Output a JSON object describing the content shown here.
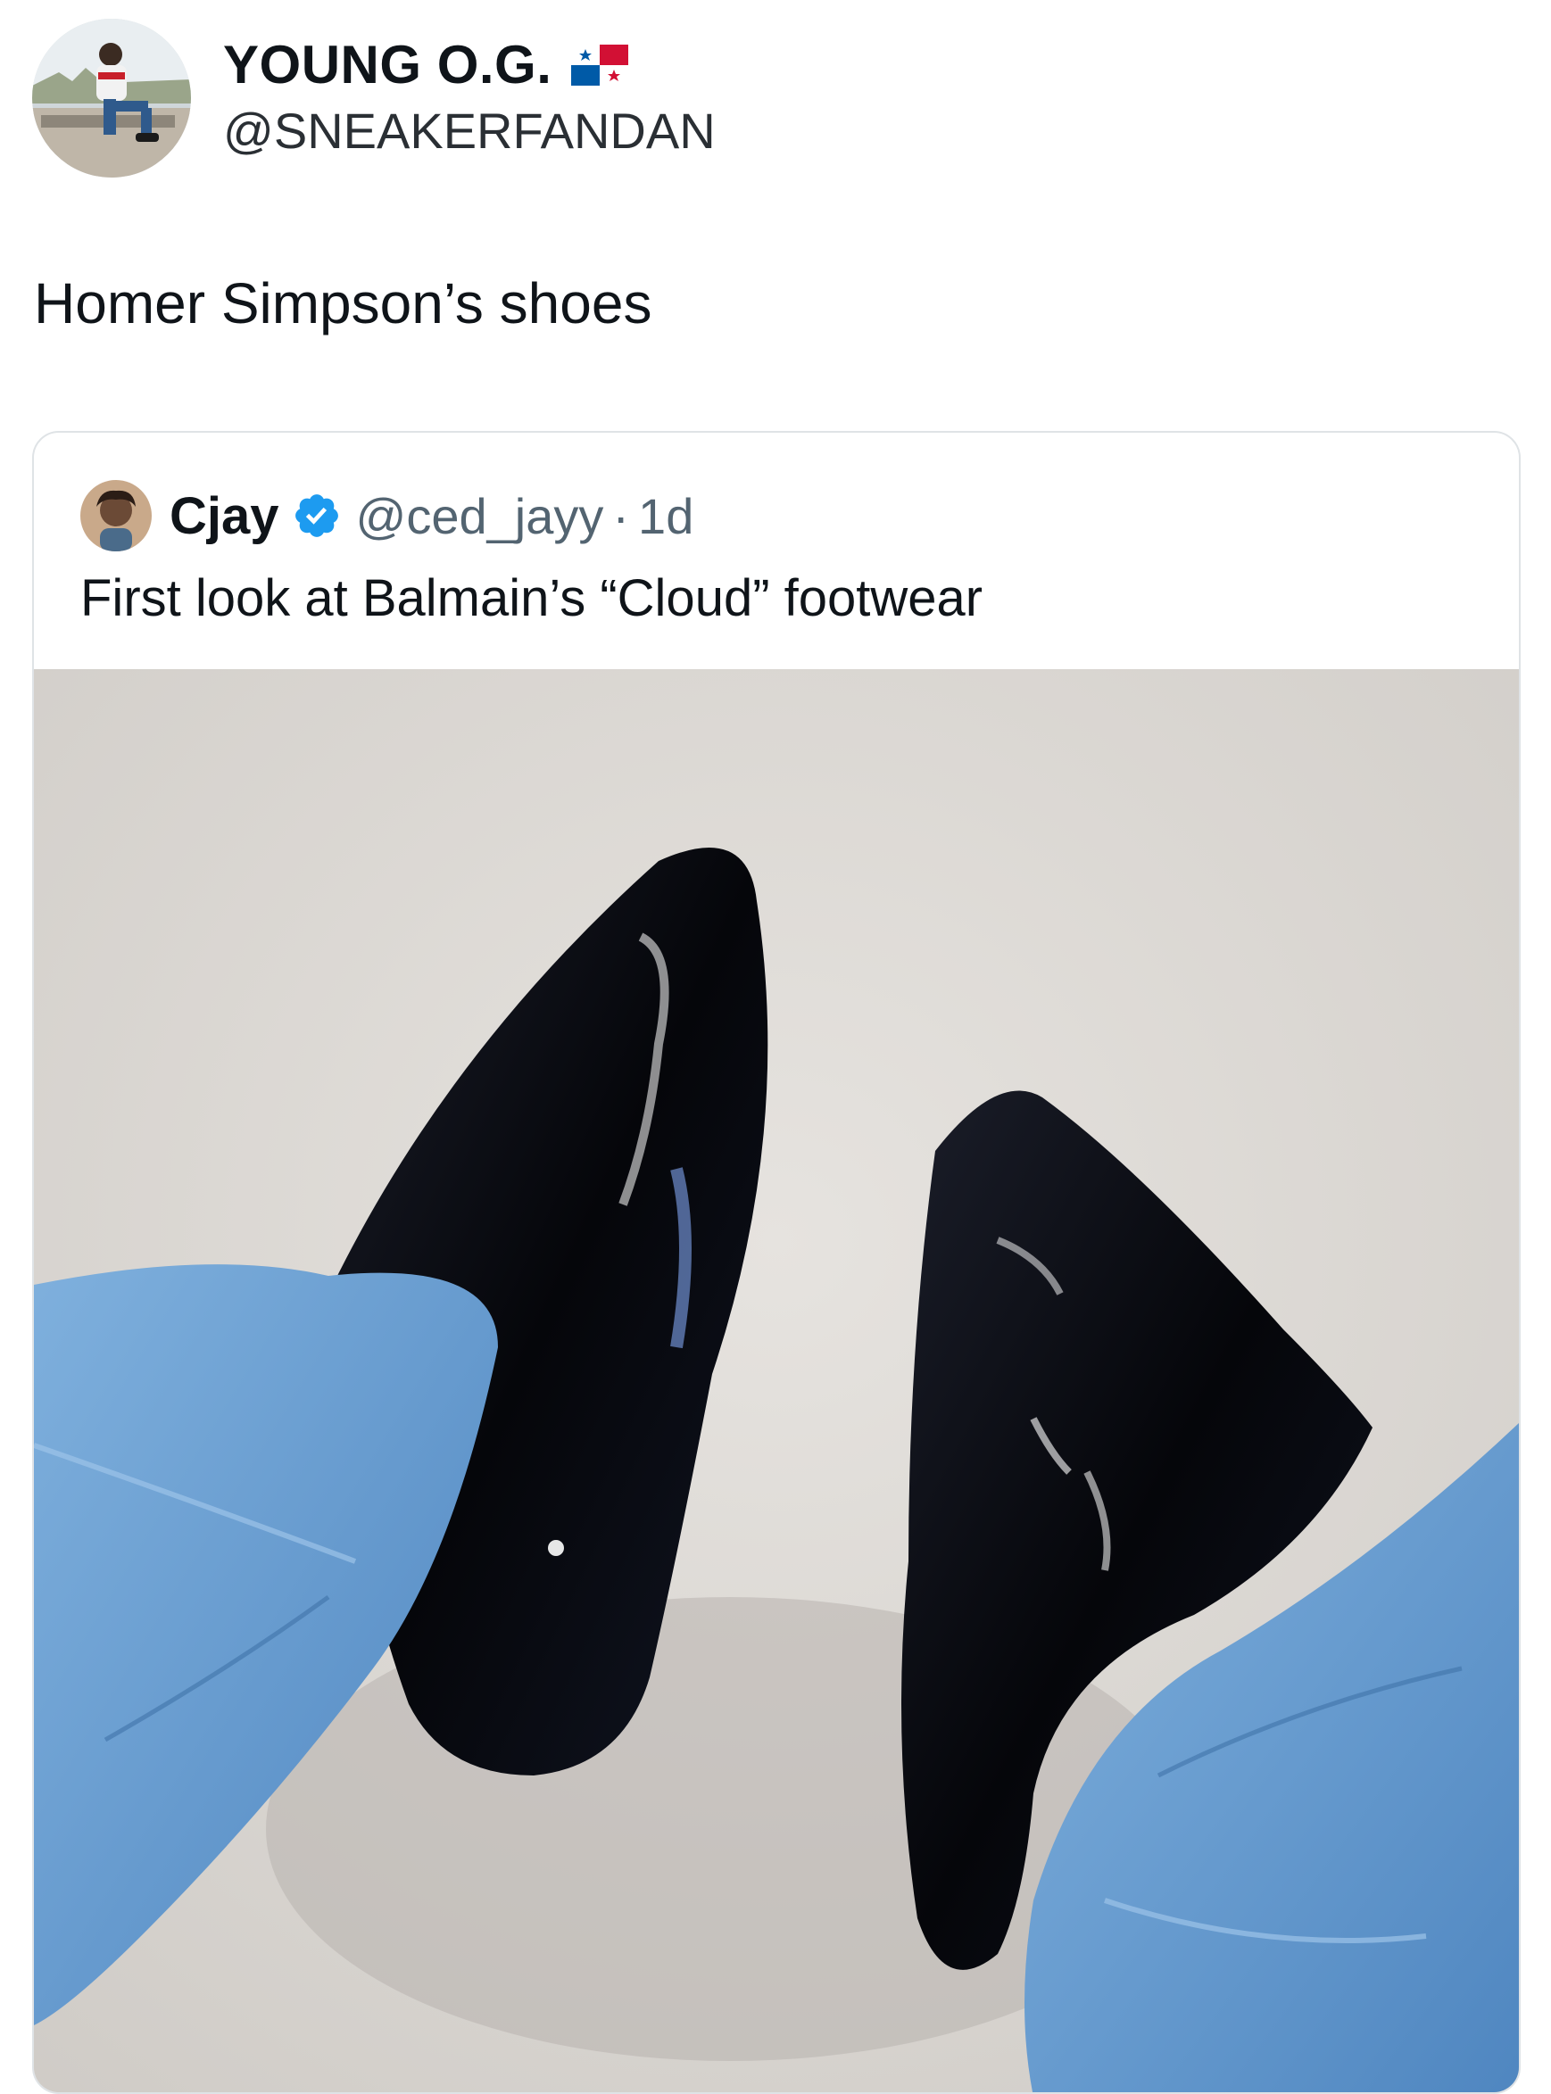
{
  "post": {
    "author_name": "YOUNG O.G.",
    "author_handle": "@SNEAKERFANDAN",
    "flag_icon": "panama-flag-icon",
    "text": "Homer Simpson’s shoes"
  },
  "quoted_post": {
    "author_name": "Cjay",
    "verified": true,
    "author_handle": "@ced_jayy",
    "separator": "·",
    "time": "1d",
    "text": "First look at Balmain’s “Cloud” footwear",
    "media_icon": "photo"
  },
  "colors": {
    "text_primary": "#0f1419",
    "text_secondary": "#536471",
    "verified_blue": "#1d9bf0",
    "border": "#dfe3e6"
  }
}
